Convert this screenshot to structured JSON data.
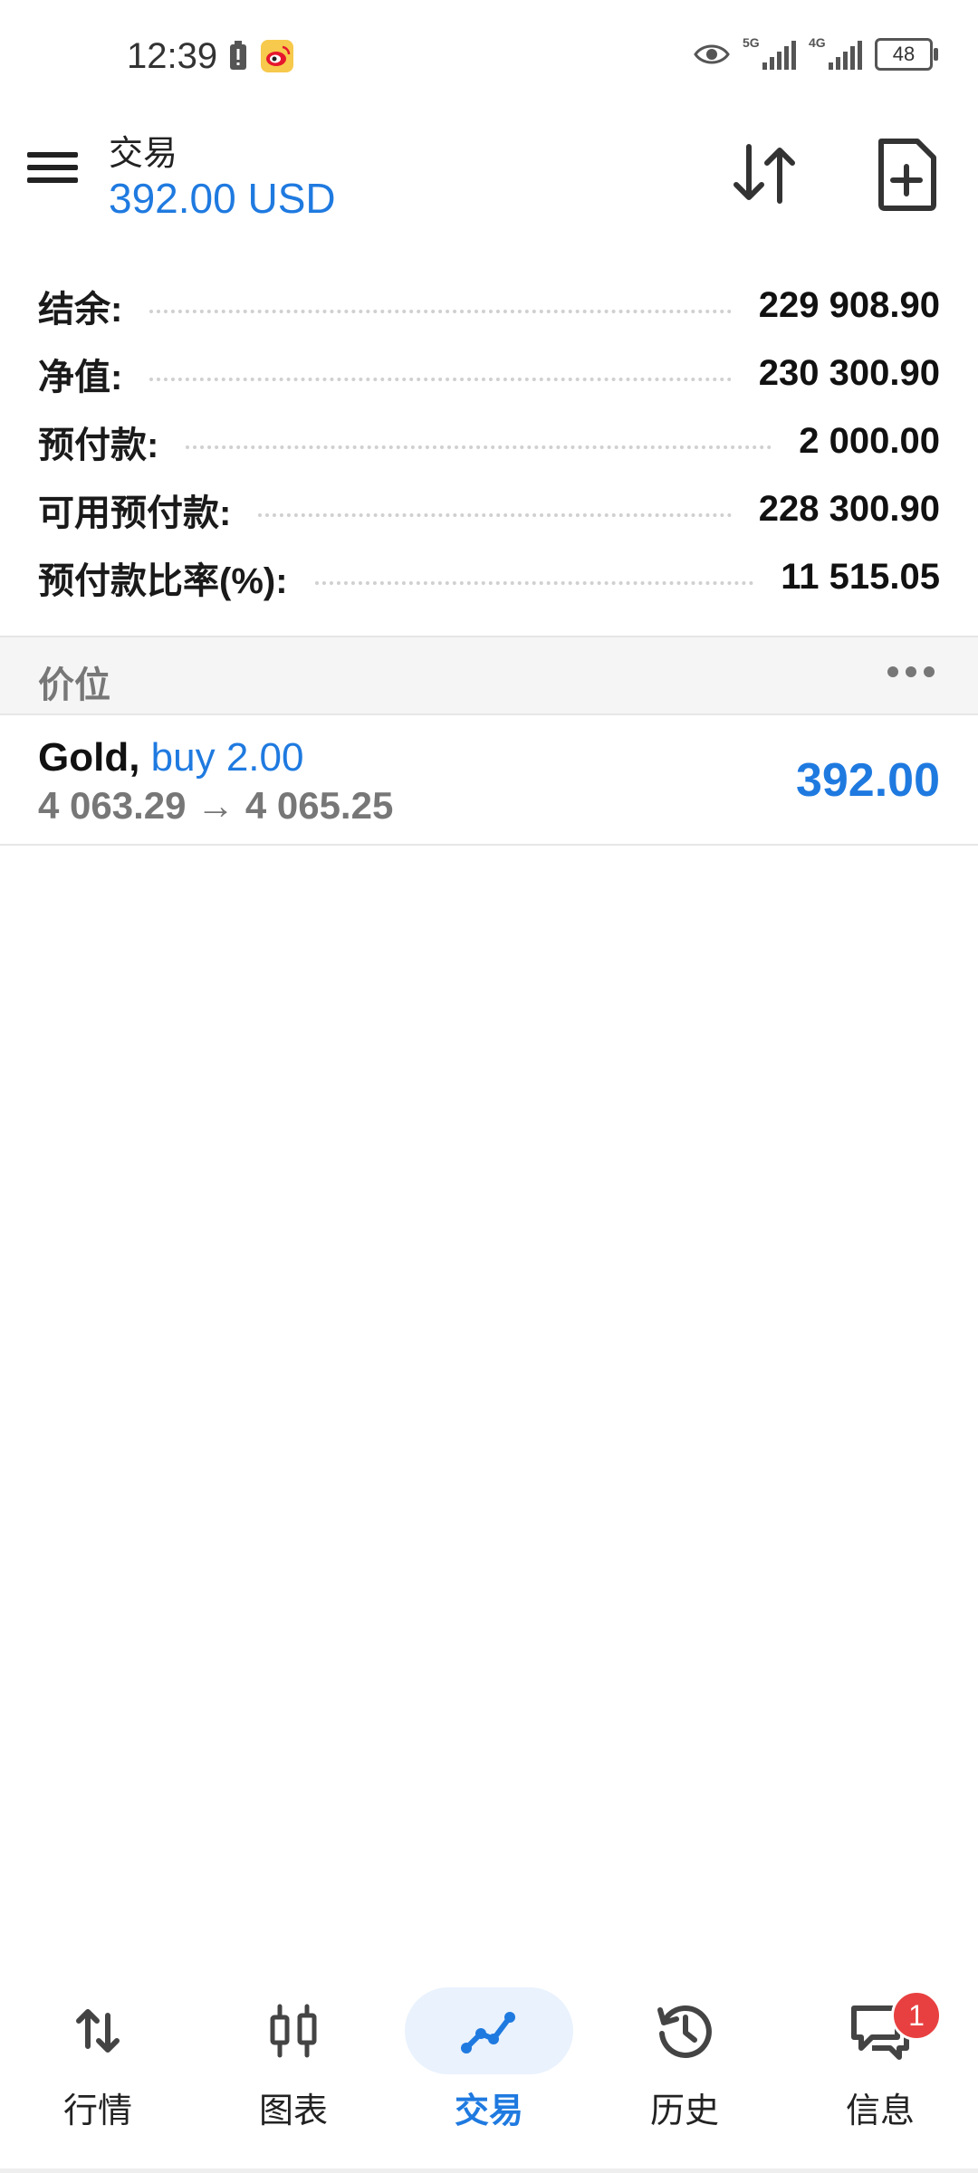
{
  "status_bar": {
    "time": "12:39",
    "net1_tag": "5G",
    "net2_tag": "4G",
    "battery": "48",
    "icons": [
      "battery-alert-icon",
      "weibo-icon",
      "eye-icon",
      "signal-icon",
      "signal-icon",
      "battery-icon"
    ]
  },
  "header": {
    "title": "交易",
    "subtitle": "392.00 USD"
  },
  "summary": [
    {
      "label": "结余:",
      "value": "229 908.90"
    },
    {
      "label": "净值:",
      "value": "230 300.90"
    },
    {
      "label": "预付款:",
      "value": "2 000.00"
    },
    {
      "label": "可用预付款:",
      "value": "228 300.90"
    },
    {
      "label": "预付款比率(%):",
      "value": "11 515.05"
    }
  ],
  "positions_section": {
    "title": "价位"
  },
  "position": {
    "symbol": "Gold,",
    "direction": "buy 2.00",
    "prices": "4 063.29 → 4 065.25",
    "profit": "392.00"
  },
  "nav": [
    {
      "label": "行情",
      "icon": "quotes-arrows-icon"
    },
    {
      "label": "图表",
      "icon": "chart-candles-icon"
    },
    {
      "label": "交易",
      "icon": "trade-line-icon",
      "active": true
    },
    {
      "label": "历史",
      "icon": "history-icon"
    },
    {
      "label": "信息",
      "icon": "messages-icon",
      "badge": "1"
    }
  ],
  "colors": {
    "accent": "#1f7ae0",
    "badge": "#e84040"
  }
}
